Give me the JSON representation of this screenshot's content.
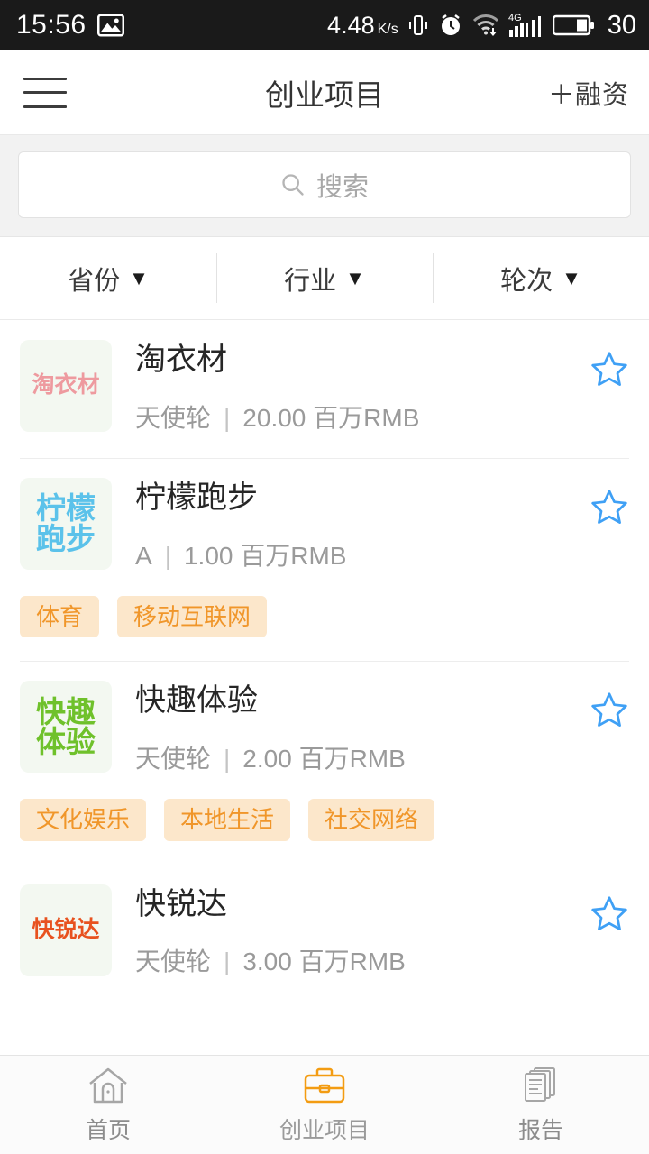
{
  "statusbar": {
    "time": "15:56",
    "photo_icon": "image-icon",
    "speed": "4.48",
    "speed_unit": "K/s",
    "vibrate_icon": "vibrate-icon",
    "alarm_icon": "alarm-icon",
    "wifi_icon": "wifi-icon",
    "network_type": "4G",
    "signal_icon": "signal-bars-icon",
    "battery_icon": "battery-icon",
    "battery_level": "30"
  },
  "header": {
    "menu_icon": "hamburger-menu-icon",
    "title": "创业项目",
    "action_label": "＋融资"
  },
  "search": {
    "icon": "search-icon",
    "placeholder": "搜索",
    "value": ""
  },
  "filters": [
    {
      "label": "省份",
      "caret": "▼"
    },
    {
      "label": "行业",
      "caret": "▼"
    },
    {
      "label": "轮次",
      "caret": "▼"
    }
  ],
  "colors": {
    "accent_orange": "#f0962a",
    "tag_bg": "#fce7cb",
    "star_blue": "#3fa0f5",
    "logo_bg": "#f3f8f1",
    "text_dark": "#262626",
    "text_gray": "#9a9a9a",
    "statusbar_bg": "#1a1a1a"
  },
  "list": [
    {
      "logo_text": "淘衣材",
      "logo_color": "#ee9a9f",
      "logo_layout": "one-line",
      "name": "淘衣材",
      "round": "天使轮",
      "separator": "|",
      "amount": "20.00 百万RMB",
      "tags": [],
      "star_icon": "star-outline-icon",
      "starred": false
    },
    {
      "logo_text": "柠檬跑步",
      "logo_color": "#5bc2ea",
      "logo_layout": "grid2",
      "name": "柠檬跑步",
      "round": "A",
      "separator": "|",
      "amount": "1.00 百万RMB",
      "tags": [
        "体育",
        "移动互联网"
      ],
      "star_icon": "star-outline-icon",
      "starred": false
    },
    {
      "logo_text": "快趣体验",
      "logo_color": "#6fc12b",
      "logo_layout": "grid2",
      "name": "快趣体验",
      "round": "天使轮",
      "separator": "|",
      "amount": "2.00 百万RMB",
      "tags": [
        "文化娱乐",
        "本地生活",
        "社交网络"
      ],
      "star_icon": "star-outline-icon",
      "starred": false
    },
    {
      "logo_text": "快锐达",
      "logo_color": "#e8521f",
      "logo_layout": "one-line",
      "name": "快锐达",
      "round": "天使轮",
      "separator": "|",
      "amount": "3.00 百万RMB",
      "tags": [],
      "star_icon": "star-outline-icon",
      "starred": false
    }
  ],
  "bottomnav": [
    {
      "label": "首页",
      "icon": "home-icon",
      "active": false
    },
    {
      "label": "创业项目",
      "icon": "briefcase-icon",
      "active": true
    },
    {
      "label": "报告",
      "icon": "documents-icon",
      "active": false
    }
  ]
}
